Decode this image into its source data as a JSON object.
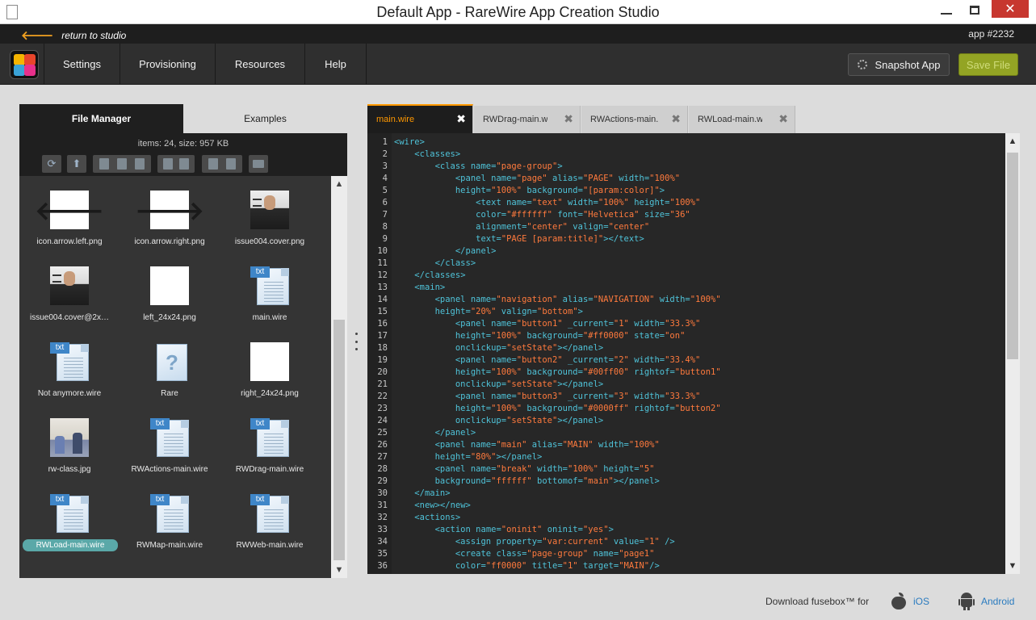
{
  "window": {
    "title": "Default App - RareWire App Creation Studio",
    "close_glyph": "✕"
  },
  "studio_bar": {
    "back_label": "return to studio",
    "back_icon": "arrow-left-icon",
    "app_id": "app #2232"
  },
  "nav": {
    "items": [
      "Settings",
      "Provisioning",
      "Resources",
      "Help"
    ],
    "snapshot_label": "Snapshot App",
    "save_label": "Save File",
    "save_color": "#93a424"
  },
  "file_panel": {
    "tabs": [
      "File Manager",
      "Examples"
    ],
    "active_tab": "File Manager",
    "summary": "items: 24, size: 957 KB",
    "toolbar_icons": [
      "refresh-icon",
      "upload-icon",
      "new-file-icon",
      "new-folder-icon",
      "delete-icon",
      "save-icon",
      "save-as-icon",
      "copy-icon",
      "paste-icon",
      "properties-icon"
    ],
    "files": [
      {
        "name": "icon.arrow.left.png",
        "thumb": "arrow-left",
        "glyph": "🡐"
      },
      {
        "name": "icon.arrow.right.png",
        "thumb": "arrow-right",
        "glyph": "🡒"
      },
      {
        "name": "issue004.cover.png",
        "thumb": "photo"
      },
      {
        "name": "issue004.cover@2x…",
        "thumb": "photo"
      },
      {
        "name": "left_24x24.png",
        "thumb": "white"
      },
      {
        "name": "main.wire",
        "thumb": "doc",
        "tag": "txt"
      },
      {
        "name": "Not anymore.wire",
        "thumb": "doc",
        "tag": "txt"
      },
      {
        "name": "Rare",
        "thumb": "unknown",
        "glyph": "?"
      },
      {
        "name": "right_24x24.png",
        "thumb": "white"
      },
      {
        "name": "rw-class.jpg",
        "thumb": "class"
      },
      {
        "name": "RWActions-main.wire",
        "thumb": "doc",
        "tag": "txt"
      },
      {
        "name": "RWDrag-main.wire",
        "thumb": "doc",
        "tag": "txt"
      },
      {
        "name": "RWLoad-main.wire",
        "thumb": "doc",
        "tag": "txt",
        "selected": true
      },
      {
        "name": "RWMap-main.wire",
        "thumb": "doc",
        "tag": "txt"
      },
      {
        "name": "RWWeb-main.wire",
        "thumb": "doc",
        "tag": "txt"
      }
    ]
  },
  "editor": {
    "tabs": [
      {
        "label": "main.wire",
        "active": true
      },
      {
        "label": "RWDrag-main.wire",
        "active": false
      },
      {
        "label": "RWActions-main.wire",
        "active": false
      },
      {
        "label": "RWLoad-main.wire",
        "active": false
      }
    ],
    "tab_close_glyph": "✖",
    "accent_color": "#ff9800",
    "lines": [
      {
        "n": "1",
        "code": "<wire>"
      },
      {
        "n": "2",
        "code": "    <classes>"
      },
      {
        "n": "3",
        "code": "        <class name=\"page-group\">"
      },
      {
        "n": "4",
        "code": "            <panel name=\"page\" alias=\"PAGE\" width=\"100%\""
      },
      {
        "n": "5",
        "code": "            height=\"100%\" background=\"[param:color]\">"
      },
      {
        "n": "6",
        "code": "                <text name=\"text\" width=\"100%\" height=\"100%\""
      },
      {
        "n": "7",
        "code": "                color=\"#ffffff\" font=\"Helvetica\" size=\"36\""
      },
      {
        "n": "8",
        "code": "                alignment=\"center\" valign=\"center\""
      },
      {
        "n": "9",
        "code": "                text=\"PAGE [param:title]\"></text>"
      },
      {
        "n": "10",
        "code": "            </panel>"
      },
      {
        "n": "11",
        "code": "        </class>"
      },
      {
        "n": "12",
        "code": "    </classes>"
      },
      {
        "n": "13",
        "code": "    <main>"
      },
      {
        "n": "14",
        "code": "        <panel name=\"navigation\" alias=\"NAVIGATION\" width=\"100%\""
      },
      {
        "n": "15",
        "code": "        height=\"20%\" valign=\"bottom\">"
      },
      {
        "n": "16",
        "code": "            <panel name=\"button1\" _current=\"1\" width=\"33.3%\""
      },
      {
        "n": "17",
        "code": "            height=\"100%\" background=\"#ff0000\" state=\"on\""
      },
      {
        "n": "18",
        "code": "            onclickup=\"setState\"></panel>"
      },
      {
        "n": "19",
        "code": "            <panel name=\"button2\" _current=\"2\" width=\"33.4%\""
      },
      {
        "n": "20",
        "code": "            height=\"100%\" background=\"#00ff00\" rightof=\"button1\""
      },
      {
        "n": "21",
        "code": "            onclickup=\"setState\"></panel>"
      },
      {
        "n": "22",
        "code": "            <panel name=\"button3\" _current=\"3\" width=\"33.3%\""
      },
      {
        "n": "23",
        "code": "            height=\"100%\" background=\"#0000ff\" rightof=\"button2\""
      },
      {
        "n": "24",
        "code": "            onclickup=\"setState\"></panel>"
      },
      {
        "n": "25",
        "code": "        </panel>"
      },
      {
        "n": "26",
        "code": "        <panel name=\"main\" alias=\"MAIN\" width=\"100%\""
      },
      {
        "n": "27",
        "code": "        height=\"80%\"></panel>"
      },
      {
        "n": "28",
        "code": "        <panel name=\"break\" width=\"100%\" height=\"5\""
      },
      {
        "n": "29",
        "code": "        background=\"ffffff\" bottomof=\"main\"></panel>"
      },
      {
        "n": "30",
        "code": "    </main>"
      },
      {
        "n": "31",
        "code": "    <new></new>"
      },
      {
        "n": "32",
        "code": "    <actions>"
      },
      {
        "n": "33",
        "code": "        <action name=\"oninit\" oninit=\"yes\">"
      },
      {
        "n": "34",
        "code": "            <assign property=\"var:current\" value=\"1\" />"
      },
      {
        "n": "35",
        "code": "            <create class=\"page-group\" name=\"page1\""
      },
      {
        "n": "36",
        "code": "            color=\"ff0000\" title=\"1\" target=\"MAIN\"/>"
      }
    ]
  },
  "footer": {
    "download_text": "Download fusebox™ for",
    "ios_label": "iOS",
    "android_label": "Android",
    "link_color": "#2a7bbf"
  }
}
